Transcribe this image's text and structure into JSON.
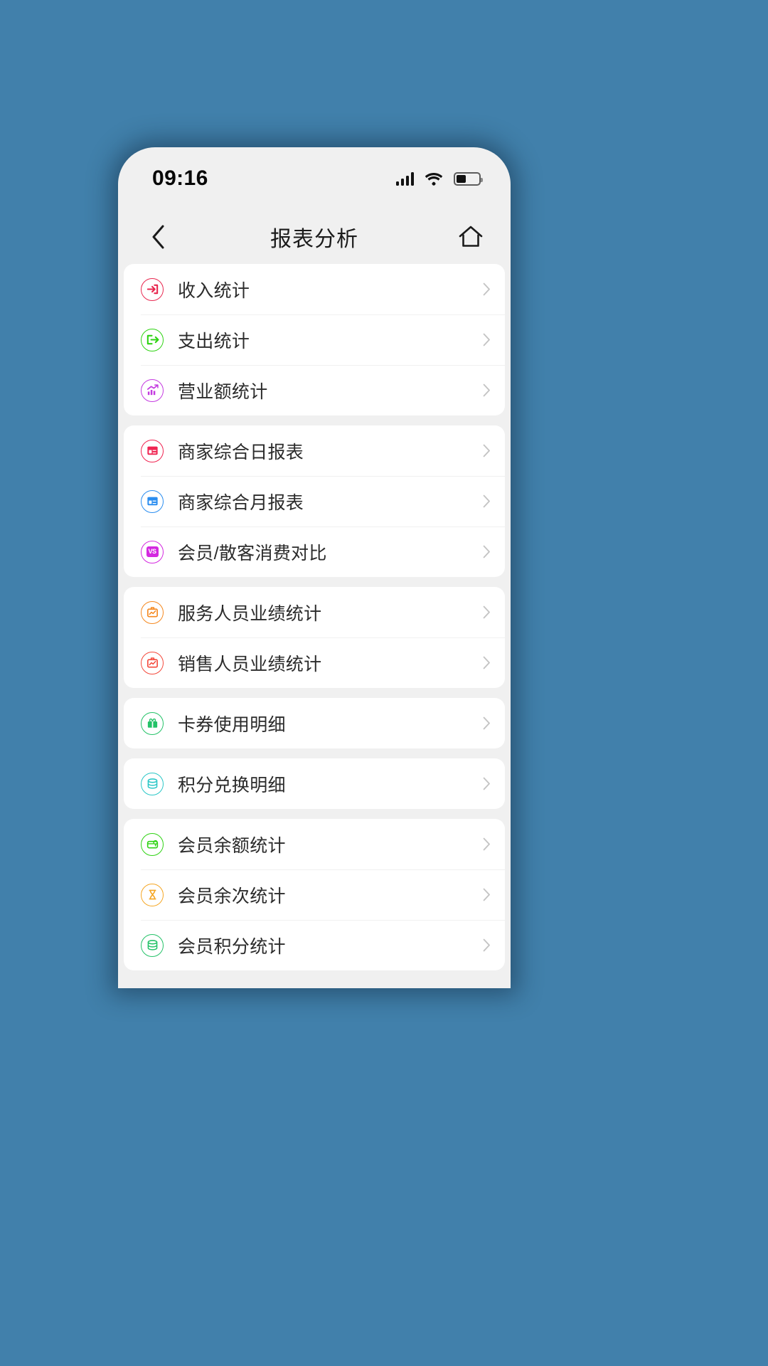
{
  "status_bar": {
    "time": "09:16",
    "signal_icon": "signal-bars-icon",
    "signal_bars": 4,
    "wifi_icon": "wifi-icon",
    "battery_icon": "battery-icon",
    "battery_level_percent": 42
  },
  "nav": {
    "back_icon": "chevron-left-icon",
    "title": "报表分析",
    "home_icon": "home-icon"
  },
  "colors": {
    "background": "#4180ab",
    "phone_bg": "#f0f0f0",
    "card_bg": "#ffffff",
    "text": "#2b2b2b",
    "chevron": "#c4c4c4",
    "divider": "#f0f0f0"
  },
  "groups": [
    {
      "items": [
        {
          "label": "收入统计",
          "icon": "arrow-into-box-icon",
          "color": "#e8274f"
        },
        {
          "label": "支出统计",
          "icon": "arrow-out-of-box-icon",
          "color": "#2fd313"
        },
        {
          "label": "营业额统计",
          "icon": "bar-chart-trend-icon",
          "color": "#c43ae0"
        }
      ]
    },
    {
      "items": [
        {
          "label": "商家综合日报表",
          "icon": "report-window-icon",
          "color": "#f02552"
        },
        {
          "label": "商家综合月报表",
          "icon": "report-window-icon",
          "color": "#2a8df0"
        },
        {
          "label": "会员/散客消费对比",
          "icon": "vs-compare-icon",
          "color": "#d428e0"
        }
      ]
    },
    {
      "items": [
        {
          "label": "服务人员业绩统计",
          "icon": "performance-chart-icon",
          "color": "#f5881f"
        },
        {
          "label": "销售人员业绩统计",
          "icon": "performance-chart-icon",
          "color": "#f4493c"
        }
      ]
    },
    {
      "items": [
        {
          "label": "卡券使用明细",
          "icon": "gift-card-icon",
          "color": "#24c268"
        }
      ]
    },
    {
      "items": [
        {
          "label": "积分兑换明细",
          "icon": "coins-stack-icon",
          "color": "#2bc7c7"
        }
      ]
    },
    {
      "items": [
        {
          "label": "会员余额统计",
          "icon": "wallet-balance-icon",
          "color": "#2fd313"
        },
        {
          "label": "会员余次统计",
          "icon": "hourglass-count-icon",
          "color": "#f5a623"
        },
        {
          "label": "会员积分统计",
          "icon": "coins-stack-icon",
          "color": "#24c268"
        }
      ]
    }
  ]
}
